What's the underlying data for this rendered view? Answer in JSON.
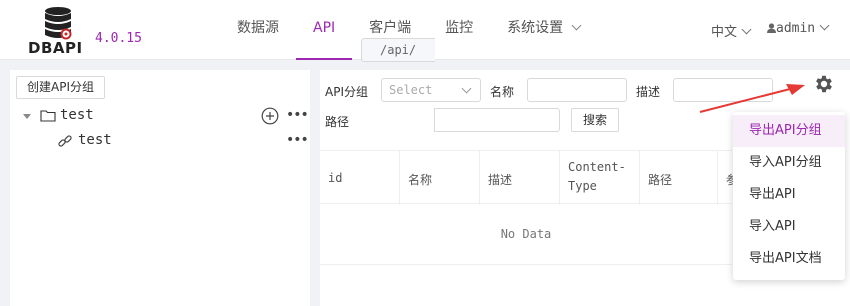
{
  "app": {
    "logo_text": "DBAPI",
    "version": "4.0.15"
  },
  "nav": {
    "items": [
      {
        "label": "数据源",
        "active": false
      },
      {
        "label": "API",
        "active": true
      },
      {
        "label": "客户端",
        "active": false
      },
      {
        "label": "监控",
        "active": false
      },
      {
        "label": "系统设置",
        "active": false,
        "has_dropdown": true
      }
    ]
  },
  "header_right": {
    "language": "中文",
    "user": "admin"
  },
  "left_panel": {
    "create_button": "创建API分组",
    "tree": {
      "group_label": "test",
      "child_label": "test"
    }
  },
  "filters": {
    "group_label": "API分组",
    "group_placeholder": "Select",
    "name_label": "名称",
    "name_value": "",
    "desc_label": "描述",
    "desc_value": "",
    "path_label": "路径",
    "path_prefix": "/api/",
    "path_value": "",
    "search_button": "搜索"
  },
  "table": {
    "columns": [
      "id",
      "名称",
      "描述",
      "Content-Type",
      "路径",
      "参"
    ],
    "empty_text": "No Data"
  },
  "dropdown_menu": {
    "items": [
      "导出API分组",
      "导入API分组",
      "导出API",
      "导入API",
      "导出API文档"
    ],
    "highlighted_index": 0
  },
  "colors": {
    "accent": "#9c27b0",
    "arrow": "#e53935"
  },
  "icons": {
    "logo": "database-icon",
    "settings": "gear-icon",
    "add": "plus-circle-icon",
    "more": "more-icon",
    "folder": "folder-icon",
    "api": "link-icon",
    "user": "user-icon"
  }
}
